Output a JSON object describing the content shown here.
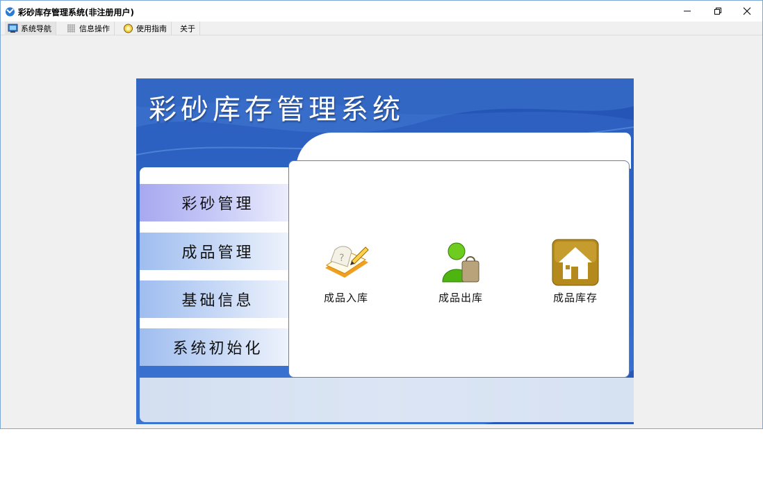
{
  "window": {
    "title": "彩砂库存管理系统(非注册用户)",
    "minimize_glyph": "—",
    "restore_glyph": "❐",
    "close_glyph": "✕"
  },
  "menu": [
    {
      "label": "系统导航",
      "icon": "monitor-icon"
    },
    {
      "label": "信息操作",
      "icon": "grid-icon"
    },
    {
      "label": "使用指南",
      "icon": "help-icon"
    },
    {
      "label": "关于",
      "icon": ""
    }
  ],
  "panel": {
    "title": "彩砂库存管理系统"
  },
  "nav": [
    {
      "label": "彩砂管理",
      "active": true
    },
    {
      "label": "成品管理",
      "active": false
    },
    {
      "label": "基础信息",
      "active": false
    },
    {
      "label": "系统初始化",
      "active": false
    }
  ],
  "tiles": [
    {
      "label": "成品入库",
      "icon": "book-pencil-icon"
    },
    {
      "label": "成品出库",
      "icon": "person-bag-icon"
    },
    {
      "label": "成品库存",
      "icon": "home-icon"
    }
  ]
}
